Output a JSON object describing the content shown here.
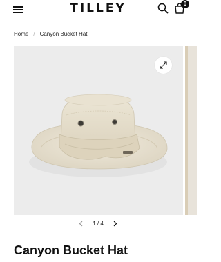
{
  "header": {
    "logo_text": "TILLEY",
    "cart_count": "0"
  },
  "breadcrumb": {
    "home_label": "Home",
    "separator": "/",
    "current_label": "Canyon Bucket Hat"
  },
  "gallery": {
    "image_alt": "Canyon Bucket Hat",
    "pager_text": "1 / 4"
  },
  "product": {
    "title": "Canyon Bucket Hat"
  },
  "colors": {
    "text": "#111111",
    "image_background": "#ececec",
    "hat_canvas": "#e7e0cf",
    "hat_band": "#ddd3bd"
  },
  "icons": {
    "menu": "hamburger-menu-icon",
    "search": "search-icon",
    "cart": "shopping-bag-icon",
    "zoom": "expand-icon",
    "prev": "chevron-left-icon",
    "next": "chevron-right-icon"
  }
}
